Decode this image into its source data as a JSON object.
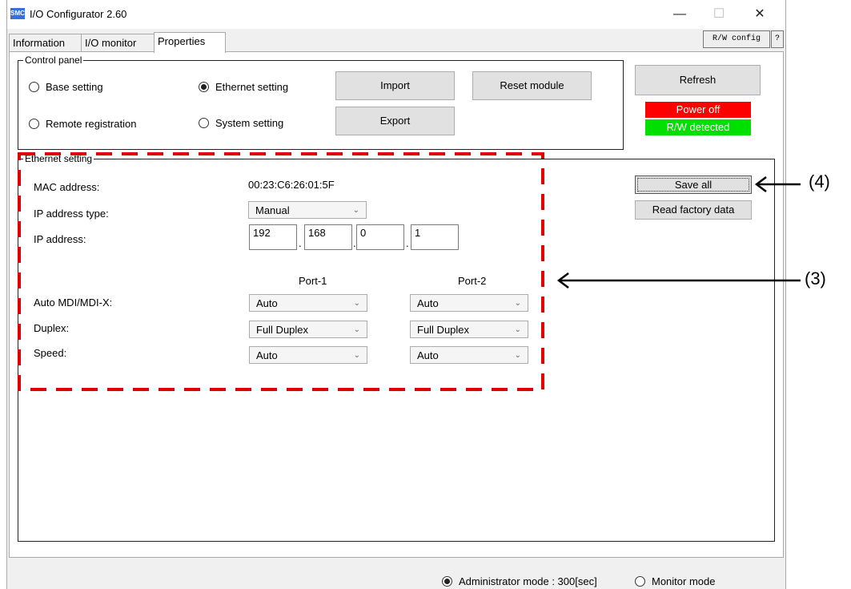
{
  "window": {
    "title": "I/O Configurator 2.60",
    "icon_text": "SMC",
    "minimize": "—",
    "maximize": "☐",
    "close": "✕",
    "rw_config": "R/W config",
    "help": "?"
  },
  "tabs": [
    "Information",
    "I/O monitor",
    "Properties"
  ],
  "control_panel": {
    "label": "Control panel",
    "radios": [
      {
        "label": "Base setting",
        "checked": false
      },
      {
        "label": "Remote registration",
        "checked": false
      },
      {
        "label": "Ethernet setting",
        "checked": true
      },
      {
        "label": "System setting",
        "checked": false
      }
    ],
    "import": "Import",
    "export": "Export",
    "reset": "Reset module"
  },
  "refresh": "Refresh",
  "status": {
    "power": "Power off",
    "power_color": "#ff0000",
    "rw": "R/W detected",
    "rw_color": "#00e000"
  },
  "ethernet": {
    "label": "Ethernet setting",
    "mac_label": "MAC address:",
    "mac_value": "00:23:C6:26:01:5F",
    "ip_type_label": "IP address type:",
    "ip_type_value": "Manual",
    "ip_label": "IP address:",
    "ip": [
      "192",
      "168",
      "0",
      "1"
    ],
    "port1": "Port-1",
    "port2": "Port-2",
    "rows": [
      {
        "label": "Auto MDI/MDI-X:",
        "p1": "Auto",
        "p2": "Auto"
      },
      {
        "label": "Duplex:",
        "p1": "Full Duplex",
        "p2": "Full Duplex"
      },
      {
        "label": "Speed:",
        "p1": "Auto",
        "p2": "Auto"
      }
    ]
  },
  "save_all": "Save all",
  "read_factory": "Read factory data",
  "footer": {
    "admin": "Administrator mode : 300[sec]",
    "monitor": "Monitor mode"
  },
  "annotations": {
    "a3": "(3)",
    "a4": "(4)",
    "highlight_color": "#e00000"
  }
}
